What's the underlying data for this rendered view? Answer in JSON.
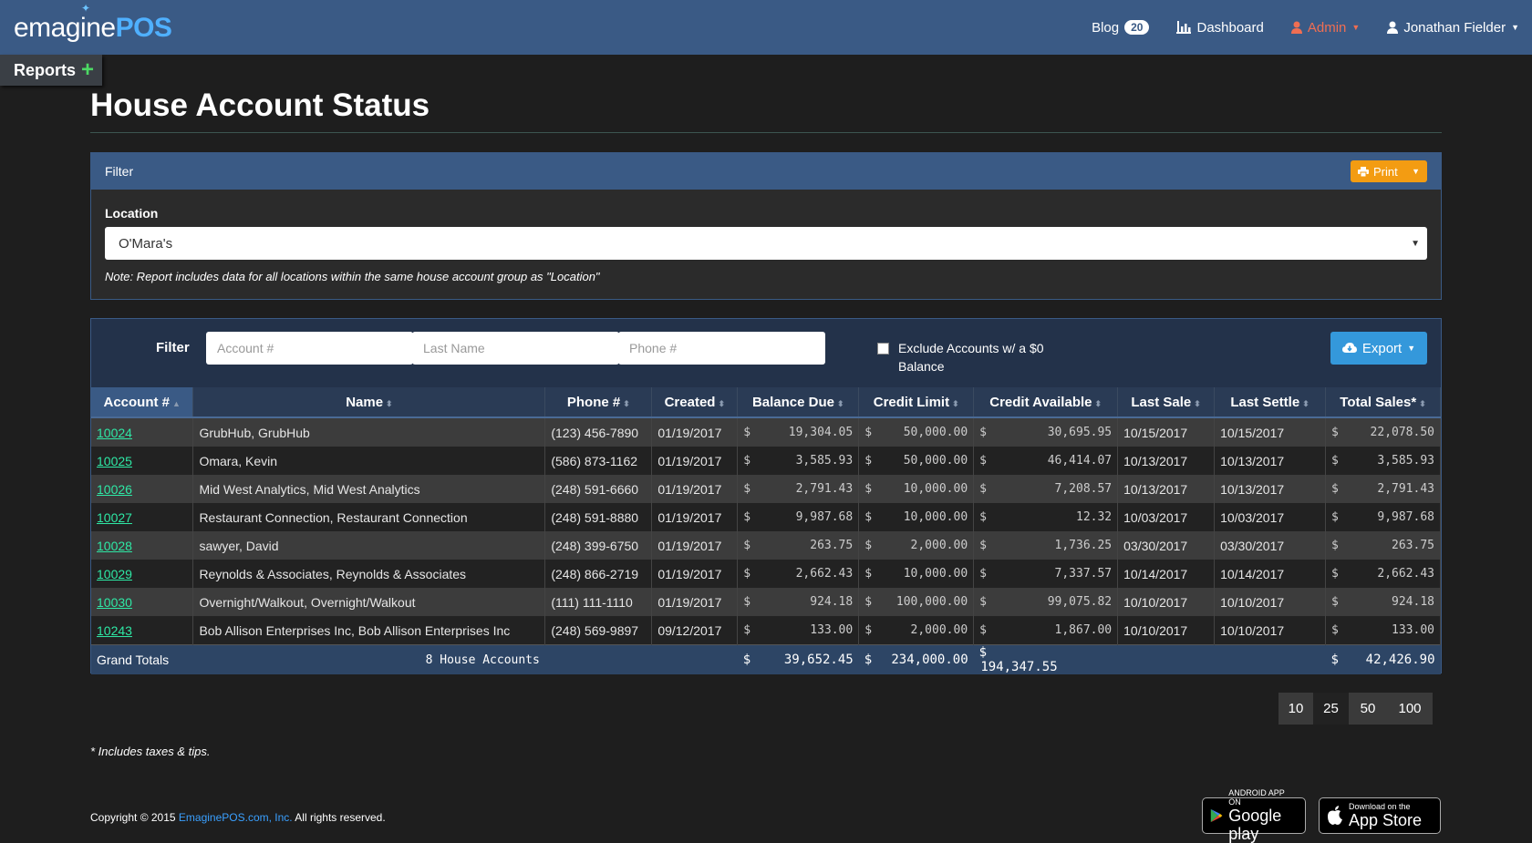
{
  "brand": {
    "part1": "emagine",
    "part2": "POS"
  },
  "nav": {
    "blog_label": "Blog",
    "blog_count": "20",
    "dashboard_label": "Dashboard",
    "admin_label": "Admin",
    "user_label": "Jonathan Fielder"
  },
  "reports_tab": "Reports",
  "page_title": "House Account Status",
  "filter_panel": {
    "title": "Filter",
    "print_label": "Print",
    "location_label": "Location",
    "location_value": "O'Mara's",
    "note": "Note: Report includes data for all locations within the same house account group as \"Location\""
  },
  "table_filter": {
    "label": "Filter",
    "account_placeholder": "Account #",
    "lastname_placeholder": "Last Name",
    "phone_placeholder": "Phone #",
    "exclude_line1": "Exclude Accounts w/ a $0",
    "exclude_line2": "Balance",
    "export_label": "Export"
  },
  "columns": [
    "Account #",
    "Name",
    "Phone #",
    "Created",
    "Balance Due",
    "Credit Limit",
    "Credit Available",
    "Last Sale",
    "Last Settle",
    "Total Sales*"
  ],
  "rows": [
    {
      "account": "10024",
      "name": "GrubHub, GrubHub",
      "phone": "(123) 456-7890",
      "created": "01/19/2017",
      "balance": "19,304.05",
      "limit": "50,000.00",
      "available": "30,695.95",
      "last_sale": "10/15/2017",
      "last_settle": "10/15/2017",
      "total_sales": "22,078.50"
    },
    {
      "account": "10025",
      "name": "Omara, Kevin",
      "phone": "(586) 873-1162",
      "created": "01/19/2017",
      "balance": "3,585.93",
      "limit": "50,000.00",
      "available": "46,414.07",
      "last_sale": "10/13/2017",
      "last_settle": "10/13/2017",
      "total_sales": "3,585.93"
    },
    {
      "account": "10026",
      "name": "Mid West Analytics, Mid West Analytics",
      "phone": "(248) 591-6660",
      "created": "01/19/2017",
      "balance": "2,791.43",
      "limit": "10,000.00",
      "available": "7,208.57",
      "last_sale": "10/13/2017",
      "last_settle": "10/13/2017",
      "total_sales": "2,791.43"
    },
    {
      "account": "10027",
      "name": "Restaurant Connection, Restaurant Connection",
      "phone": "(248) 591-8880",
      "created": "01/19/2017",
      "balance": "9,987.68",
      "limit": "10,000.00",
      "available": "12.32",
      "last_sale": "10/03/2017",
      "last_settle": "10/03/2017",
      "total_sales": "9,987.68"
    },
    {
      "account": "10028",
      "name": "sawyer, David",
      "phone": "(248) 399-6750",
      "created": "01/19/2017",
      "balance": "263.75",
      "limit": "2,000.00",
      "available": "1,736.25",
      "last_sale": "03/30/2017",
      "last_settle": "03/30/2017",
      "total_sales": "263.75"
    },
    {
      "account": "10029",
      "name": "Reynolds & Associates, Reynolds & Associates",
      "phone": "(248) 866-2719",
      "created": "01/19/2017",
      "balance": "2,662.43",
      "limit": "10,000.00",
      "available": "7,337.57",
      "last_sale": "10/14/2017",
      "last_settle": "10/14/2017",
      "total_sales": "2,662.43"
    },
    {
      "account": "10030",
      "name": "Overnight/Walkout, Overnight/Walkout",
      "phone": "(111) 111-1110",
      "created": "01/19/2017",
      "balance": "924.18",
      "limit": "100,000.00",
      "available": "99,075.82",
      "last_sale": "10/10/2017",
      "last_settle": "10/10/2017",
      "total_sales": "924.18"
    },
    {
      "account": "10243",
      "name": "Bob Allison Enterprises Inc, Bob Allison Enterprises Inc",
      "phone": "(248) 569-9897",
      "created": "09/12/2017",
      "balance": "133.00",
      "limit": "2,000.00",
      "available": "1,867.00",
      "last_sale": "10/10/2017",
      "last_settle": "10/10/2017",
      "total_sales": "133.00"
    }
  ],
  "totals": {
    "label": "Grand Totals",
    "count": "8 House Accounts",
    "balance": "39,652.45",
    "limit": "234,000.00",
    "available": "194,347.55",
    "total_sales": "42,426.90"
  },
  "currency_symbol": "$",
  "pagination": [
    "10",
    "25",
    "50",
    "100"
  ],
  "footnote": "* Includes taxes & tips.",
  "footer": {
    "copyright": "Copyright © 2015",
    "company_link": "EmaginePOS.com, Inc.",
    "rights": "All rights reserved.",
    "google_small": "ANDROID APP ON",
    "google_big": "Google play",
    "apple_small": "Download on the",
    "apple_big": "App Store"
  },
  "colors": {
    "navbar": "#3a5a85",
    "accent_link": "#2ee8a5",
    "print_button": "#f39c12",
    "export_button": "#3498db",
    "admin": "#f06e52"
  }
}
